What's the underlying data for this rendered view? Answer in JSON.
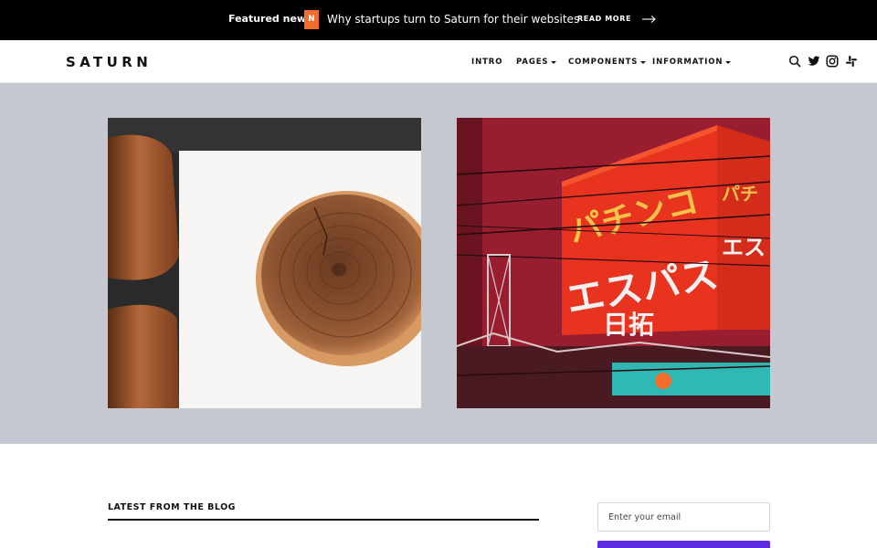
{
  "newsbar": {
    "label": "Featured news:",
    "badge": "N",
    "headline": "Why startups turn to Saturn for their websites",
    "read_more": "READ MORE"
  },
  "header": {
    "logo": "SATURN",
    "nav": [
      {
        "label": "INTRO",
        "dropdown": false
      },
      {
        "label": "PAGES",
        "dropdown": true
      },
      {
        "label": "COMPONENTS",
        "dropdown": true
      },
      {
        "label": "INFORMATION",
        "dropdown": true
      }
    ],
    "icons": [
      "search-icon",
      "twitter-icon",
      "instagram-icon",
      "slack-icon"
    ]
  },
  "hero": {
    "images": [
      "wood-slice-photo",
      "neon-sign-photo"
    ],
    "sign_text": {
      "line1": "パチンコ",
      "line2": "エスパス",
      "line3": "日拓"
    }
  },
  "blog": {
    "section_title": "LATEST FROM THE BLOG"
  },
  "newsletter": {
    "email_placeholder": "Enter your email"
  },
  "colors": {
    "topbar": "#000000",
    "badge": "#f26c2b",
    "hero_bg": "#c5c8d1",
    "accent": "#5b2be0"
  }
}
